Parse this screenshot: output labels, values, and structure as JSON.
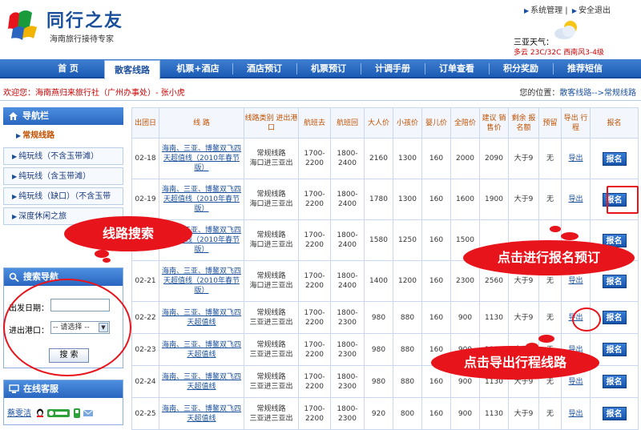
{
  "logo": {
    "name": "同行之友",
    "slogan": "海南旅行接待专家"
  },
  "top_links": {
    "system": "系统管理",
    "logout": "安全退出",
    "separator": "|"
  },
  "weather": {
    "label": "三亚天气：",
    "info": "多云 23C/32C 西南风3-4级"
  },
  "nav": {
    "items": [
      "首 页",
      "散客线路",
      "机票+酒店",
      "酒店预订",
      "机票预订",
      "计调手册",
      "订单查看",
      "积分奖励",
      "推荐短信"
    ],
    "active_index": 1
  },
  "welcome": "欢迎您：海南燕归来旅行社（广州办事处）- 张小虎",
  "location": {
    "label": "您的位置：",
    "path1": "散客线路",
    "arrow": "-->",
    "path2": "常规线路"
  },
  "sidebar": {
    "nav_title": "导航栏",
    "items": [
      {
        "label": "常规线路"
      },
      {
        "label": "纯玩线（不含玉带滩）"
      },
      {
        "label": "纯玩线（含玉带滩）"
      },
      {
        "label": "纯玩线（缺口）（不含玉带滩）"
      },
      {
        "label": "深度休闲之旅"
      }
    ],
    "search_title": "搜索导航",
    "depart_label": "出发日期：",
    "port_label": "进出港口：",
    "port_placeholder": "-- 请选择 --",
    "search_btn": "搜 索",
    "service_title": "在线客服",
    "service_name": "蔡雯洁"
  },
  "table": {
    "headers": [
      "出团日",
      "线 路",
      "线路类别 进出港口",
      "航班去",
      "航班回",
      "大人价",
      "小孩价",
      "婴儿价",
      "全陪价",
      "建议 销售价",
      "剩余 报名额",
      "预留",
      "导出 行程",
      "报名"
    ],
    "rows": [
      {
        "date": "02-18",
        "route": "海南、三亚、博鳌双飞四天超值线（2010年春节版）",
        "category": "常规线路",
        "port": "海口进三亚出",
        "go": "1700-2200",
        "back": "1800-2400",
        "adult": "2160",
        "child": "1300",
        "infant": "160",
        "escort": "2000",
        "retail": "2090",
        "remain": "大于9",
        "reserve": "无",
        "export": "导出",
        "signup": "报名"
      },
      {
        "date": "02-19",
        "route": "海南、三亚、博鳌双飞四天超值线（2010年春节版）",
        "category": "常规线路",
        "port": "海口进三亚出",
        "go": "1700-2200",
        "back": "1800-2400",
        "adult": "1780",
        "child": "1300",
        "infant": "160",
        "escort": "1600",
        "retail": "1900",
        "remain": "大于9",
        "reserve": "无",
        "export": "导出",
        "signup": "报名"
      },
      {
        "date": "",
        "route": "海南、三亚、博鳌双飞四天超值线（2010年春节版）",
        "category": "常规线路",
        "port": "海口进三亚出",
        "go": "1700-2200",
        "back": "1800-2400",
        "adult": "1580",
        "child": "1250",
        "infant": "160",
        "escort": "1500",
        "retail": "",
        "remain": "",
        "reserve": "",
        "export": "",
        "signup": "报名"
      },
      {
        "date": "02-21",
        "route": "海南、三亚、博鳌双飞四天超值线（2010年春节版）",
        "category": "常规线路",
        "port": "海口进三亚出",
        "go": "1700-2200",
        "back": "1800-2400",
        "adult": "1400",
        "child": "1200",
        "infant": "160",
        "escort": "2300",
        "retail": "2560",
        "remain": "大于9",
        "reserve": "无",
        "export": "导出",
        "signup": "报名"
      },
      {
        "date": "02-22",
        "route": "海南、三亚、博鳌双飞四天超值线",
        "category": "常规线路",
        "port": "三亚进三亚出",
        "go": "1700-2200",
        "back": "1800-2300",
        "adult": "980",
        "child": "880",
        "infant": "160",
        "escort": "900",
        "retail": "1130",
        "remain": "大于9",
        "reserve": "无",
        "export": "导出",
        "signup": "报名"
      },
      {
        "date": "02-23",
        "route": "海南、三亚、博鳌双飞四天超值线",
        "category": "常规线路",
        "port": "三亚进三亚出",
        "go": "1700-2200",
        "back": "1800-2300",
        "adult": "980",
        "child": "880",
        "infant": "160",
        "escort": "900",
        "retail": "1130",
        "remain": "大于9",
        "reserve": "无",
        "export": "导出",
        "signup": "报名"
      },
      {
        "date": "02-24",
        "route": "海南、三亚、博鳌双飞四天超值线",
        "category": "常规线路",
        "port": "三亚进三亚出",
        "go": "1700-2200",
        "back": "1800-2300",
        "adult": "980",
        "child": "880",
        "infant": "160",
        "escort": "900",
        "retail": "1130",
        "remain": "大于9",
        "reserve": "无",
        "export": "导出",
        "signup": "报名"
      },
      {
        "date": "02-25",
        "route": "海南、三亚、博鳌双飞四天超值线",
        "category": "常规线路",
        "port": "三亚进三亚出",
        "go": "1700-2200",
        "back": "1800-2300",
        "adult": "920",
        "child": "800",
        "infant": "160",
        "escort": "900",
        "retail": "1130",
        "remain": "大于9",
        "reserve": "无",
        "export": "导出",
        "signup": "报名"
      }
    ]
  },
  "annotations": {
    "route_search": "线路搜索",
    "signup_hint": "点击进行报名预订",
    "export_hint": "点击导出行程线路"
  },
  "colors": {
    "brand_blue": "#1c5bb5",
    "annotation_red": "#e8141b",
    "header_text": "#c05000"
  }
}
